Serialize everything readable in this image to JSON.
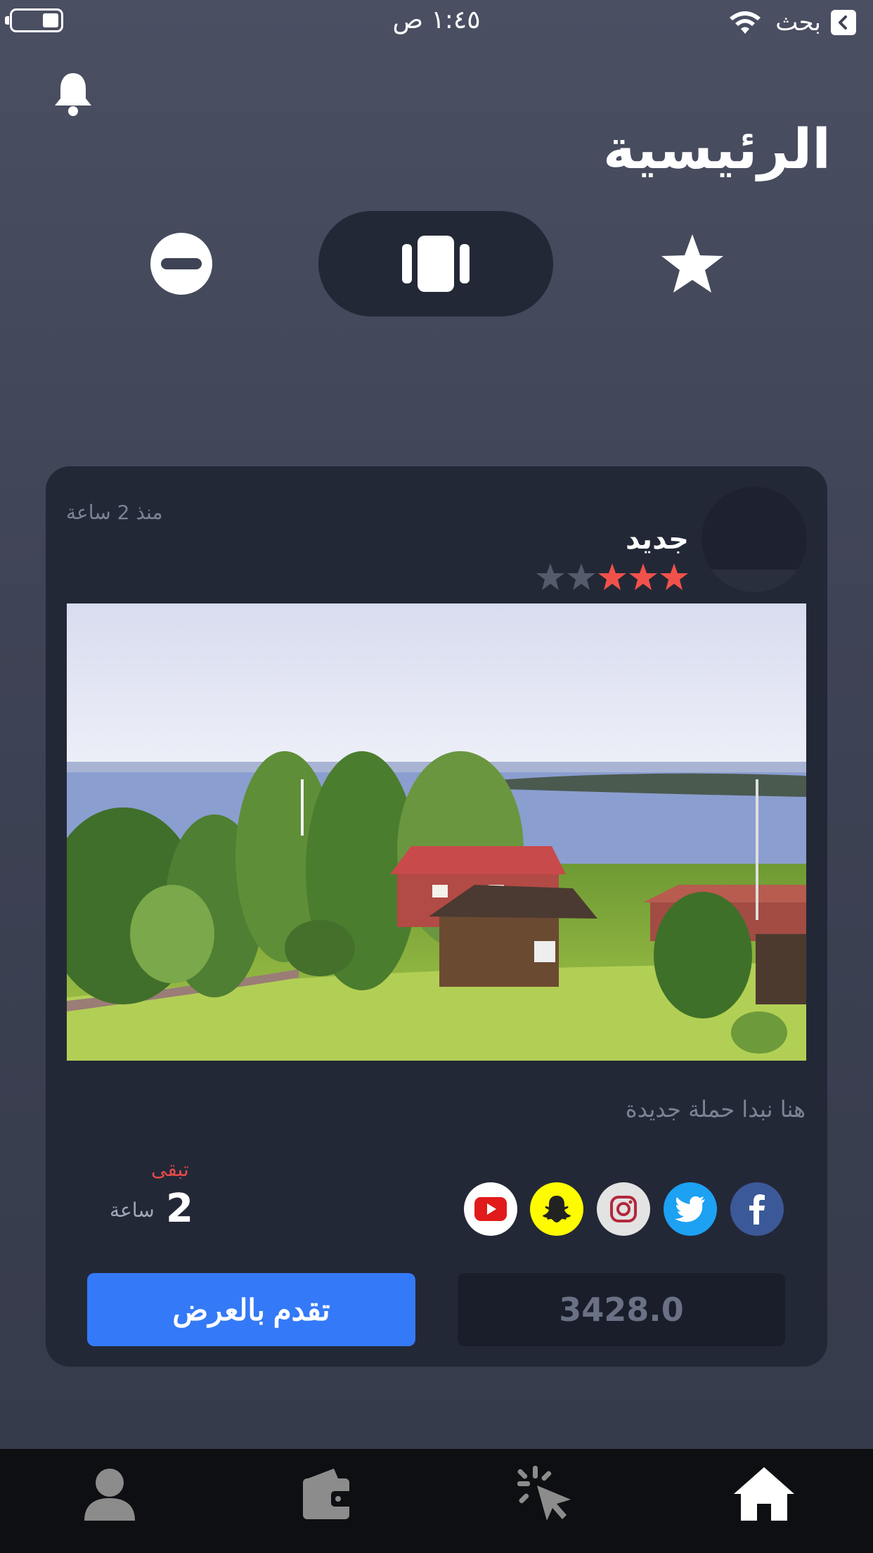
{
  "status_bar": {
    "time": "١:٤٥ ص",
    "back_label": "بحث"
  },
  "header": {
    "title": "الرئيسية"
  },
  "segments": [
    {
      "name": "favorites",
      "icon": "star-icon"
    },
    {
      "name": "cards",
      "icon": "cards-icon",
      "selected": true
    },
    {
      "name": "blocked",
      "icon": "minus-circle-icon"
    }
  ],
  "card": {
    "time_ago": "منذ 2 ساعة",
    "title": "جديد",
    "rating": 3,
    "rating_max": 5,
    "description": "هنا نبدا حملة جديدة",
    "remaining_label": "تبقى",
    "remaining_count": "2",
    "remaining_unit": "ساعة",
    "price": "3428.0",
    "bid_button": "تقدم بالعرض",
    "social": [
      "facebook",
      "twitter",
      "instagram",
      "snapchat",
      "youtube"
    ]
  },
  "colors": {
    "accent_blue": "#3479f7",
    "star_active": "#f0524b",
    "remaining_red": "#e64a4a",
    "facebook": "#3b5998",
    "twitter": "#1da1f2",
    "snapchat": "#fffc00",
    "youtube": "#ff0000"
  },
  "tabs": [
    {
      "name": "home",
      "icon": "home-icon",
      "active": true
    },
    {
      "name": "clicks",
      "icon": "cursor-click-icon"
    },
    {
      "name": "wallet",
      "icon": "wallet-icon"
    },
    {
      "name": "profile",
      "icon": "profile-icon"
    }
  ]
}
